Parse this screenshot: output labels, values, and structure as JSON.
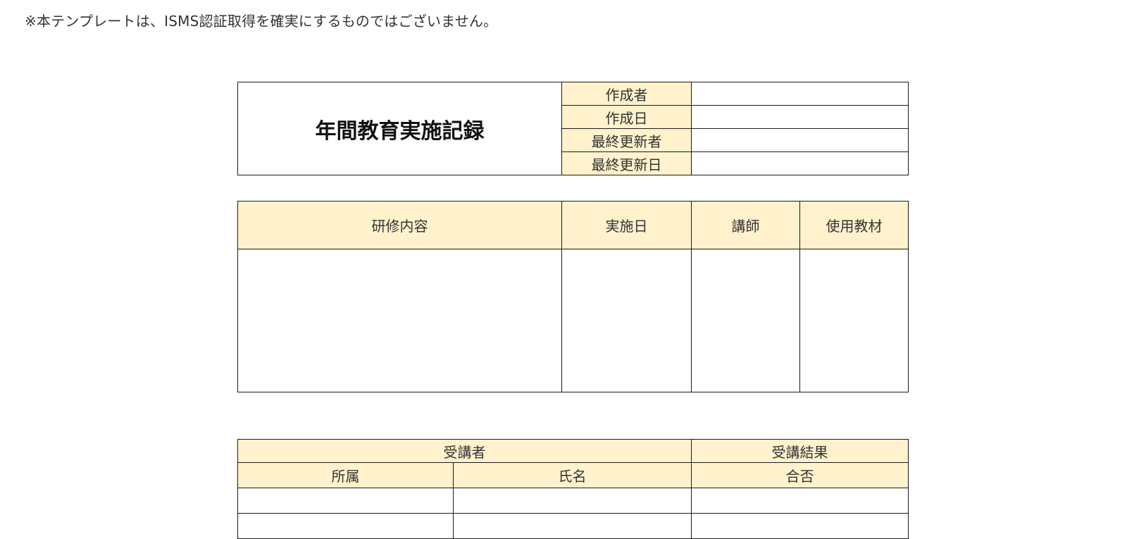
{
  "note": "※本テンプレートは、ISMS認証取得を確実にするものではございません。",
  "header_table": {
    "title": "年間教育実施記録",
    "rows": [
      {
        "label": "作成者",
        "value": ""
      },
      {
        "label": "作成日",
        "value": ""
      },
      {
        "label": "最終更新者",
        "value": ""
      },
      {
        "label": "最終更新日",
        "value": ""
      }
    ]
  },
  "training_table": {
    "headers": [
      "研修内容",
      "実施日",
      "講師",
      "使用教材"
    ],
    "row": [
      "",
      "",
      "",
      ""
    ]
  },
  "attendee_table": {
    "group_headers": [
      "受講者",
      "受講結果"
    ],
    "sub_headers": [
      "所属",
      "氏名",
      "合否"
    ],
    "rows": [
      [
        "",
        "",
        ""
      ],
      [
        "",
        "",
        ""
      ]
    ]
  }
}
